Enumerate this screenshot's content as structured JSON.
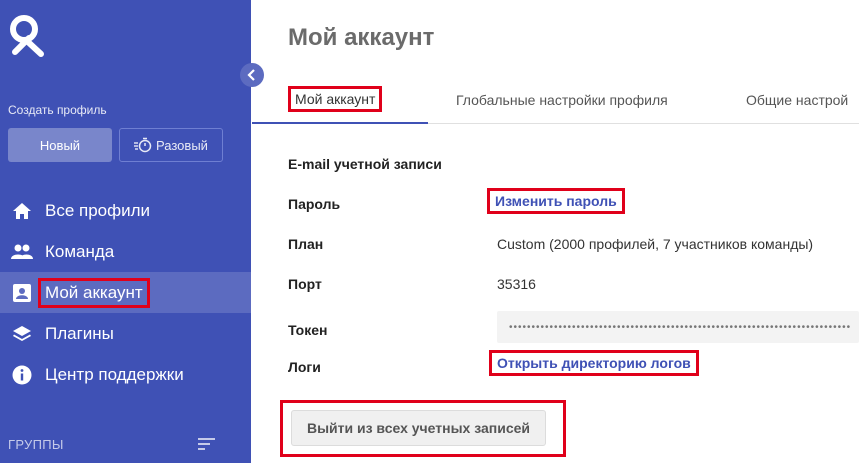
{
  "sidebar": {
    "create_profile_label": "Создать профиль",
    "new_button": "Новый",
    "once_button": "Разовый",
    "items": [
      {
        "label": "Все профили",
        "icon": "home-icon"
      },
      {
        "label": "Команда",
        "icon": "team-icon"
      },
      {
        "label": "Мой аккаунт",
        "icon": "account-icon",
        "active": true
      },
      {
        "label": "Плагины",
        "icon": "layers-icon"
      },
      {
        "label": "Центр поддержки",
        "icon": "info-icon"
      }
    ],
    "groups_label": "ГРУППЫ"
  },
  "main": {
    "title": "Мой аккаунт",
    "tabs": [
      {
        "label": "Мой аккаунт",
        "active": true
      },
      {
        "label": "Глобальные настройки профиля"
      },
      {
        "label": "Общие настрой"
      }
    ],
    "rows": {
      "email_label": "E-mail учетной записи",
      "password_label": "Пароль",
      "password_link": "Изменить пароль",
      "plan_label": "План",
      "plan_value": "Custom (2000 профилей, 7 участников команды)",
      "port_label": "Порт",
      "port_value": "35316",
      "token_label": "Токен",
      "token_value": "••••••••••••••••••••••••••••••••••••••••••••••••••••••••••••••••••••••••••••",
      "logs_label": "Логи",
      "logs_link": "Открыть директорию логов"
    },
    "logout_button": "Выйти из всех учетных записей"
  },
  "colors": {
    "sidebar_bg": "#3f51b5",
    "accent": "#3f51b5",
    "highlight": "#e0001a"
  }
}
